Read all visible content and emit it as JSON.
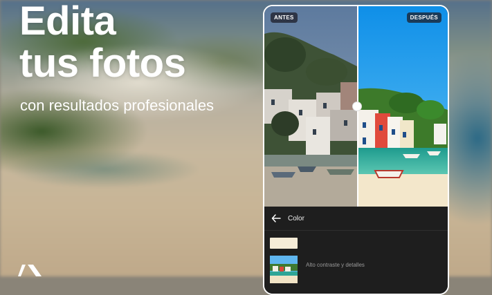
{
  "headline": {
    "line1": "Edita",
    "line2": "tus fotos"
  },
  "subheadline": "con resultados profesionales",
  "brand_logo": "adobe-logo",
  "phone": {
    "photo": {
      "before_label": "ANTES",
      "after_label": "DESPUÉS",
      "split_position": 0.51
    },
    "panel": {
      "back_icon": "arrow-left-icon",
      "title": "Color",
      "presets": [
        {
          "name": ""
        },
        {
          "name": "Alto contraste y detalles"
        }
      ]
    }
  },
  "colors": {
    "text": "#ffffff",
    "panel_bg": "#1e1e1e",
    "tag_bg": "#1e1e28",
    "sky_after": "#1aa3f0",
    "sky_before": "#6b86a8"
  }
}
